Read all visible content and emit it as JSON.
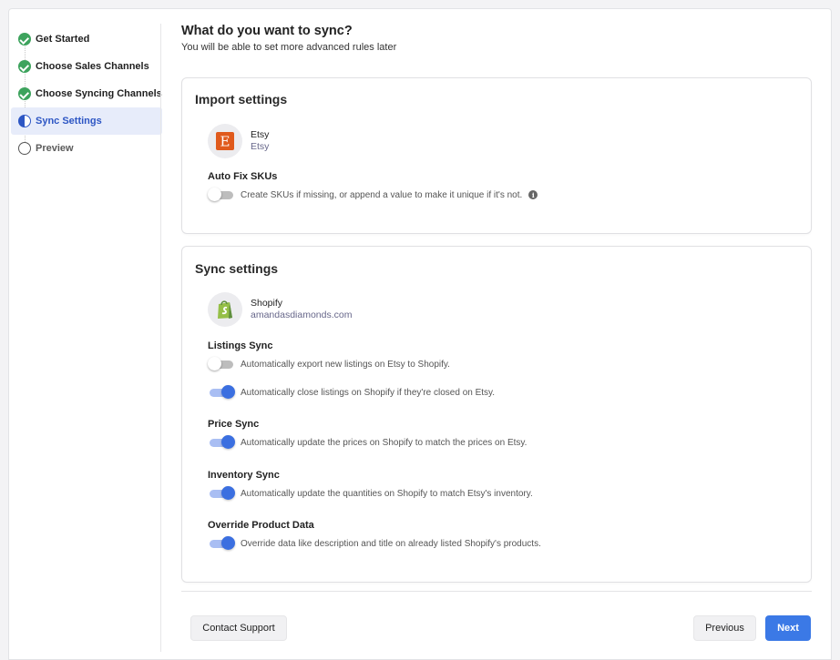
{
  "stepper": {
    "steps": [
      {
        "label": "Get Started",
        "state": "done"
      },
      {
        "label": "Choose Sales Channels",
        "state": "done"
      },
      {
        "label": "Choose Syncing Channels",
        "state": "done"
      },
      {
        "label": "Sync Settings",
        "state": "active"
      },
      {
        "label": "Preview",
        "state": "pending"
      }
    ]
  },
  "header": {
    "title": "What do you want to sync?",
    "subtitle": "You will be able to set more advanced rules later"
  },
  "import_settings": {
    "title": "Import settings",
    "channel": {
      "name": "Etsy",
      "sub": "Etsy",
      "icon": "etsy-logo-icon",
      "letter": "E",
      "color": "#e05a1c"
    },
    "auto_fix": {
      "label": "Auto Fix SKUs",
      "toggle_text": "Create SKUs if missing, or append a value to make it unique if it's not.",
      "enabled": false,
      "info_glyph": "i"
    }
  },
  "sync_settings": {
    "title": "Sync settings",
    "channel": {
      "name": "Shopify",
      "sub": "amandasdiamonds.com",
      "icon": "shopify-logo-icon",
      "color": "#95bf47"
    },
    "listings_sync": {
      "label": "Listings Sync",
      "export_text": "Automatically export new listings on Etsy to Shopify.",
      "export_enabled": false,
      "close_text": "Automatically close listings on Shopify if they're closed on Etsy.",
      "close_enabled": true
    },
    "price_sync": {
      "label": "Price Sync",
      "text": "Automatically update the prices on Shopify to match the prices on Etsy.",
      "enabled": true
    },
    "inventory_sync": {
      "label": "Inventory Sync",
      "text": "Automatically update the quantities on Shopify to match Etsy's inventory.",
      "enabled": true
    },
    "override_data": {
      "label": "Override Product Data",
      "text": "Override data like description and title on already listed Shopify's products.",
      "enabled": true
    }
  },
  "footer": {
    "contact_label": "Contact Support",
    "previous_label": "Previous",
    "next_label": "Next"
  },
  "colors": {
    "accent": "#3b79e6",
    "success": "#3da35d",
    "active_bg": "#e7ecfa"
  }
}
